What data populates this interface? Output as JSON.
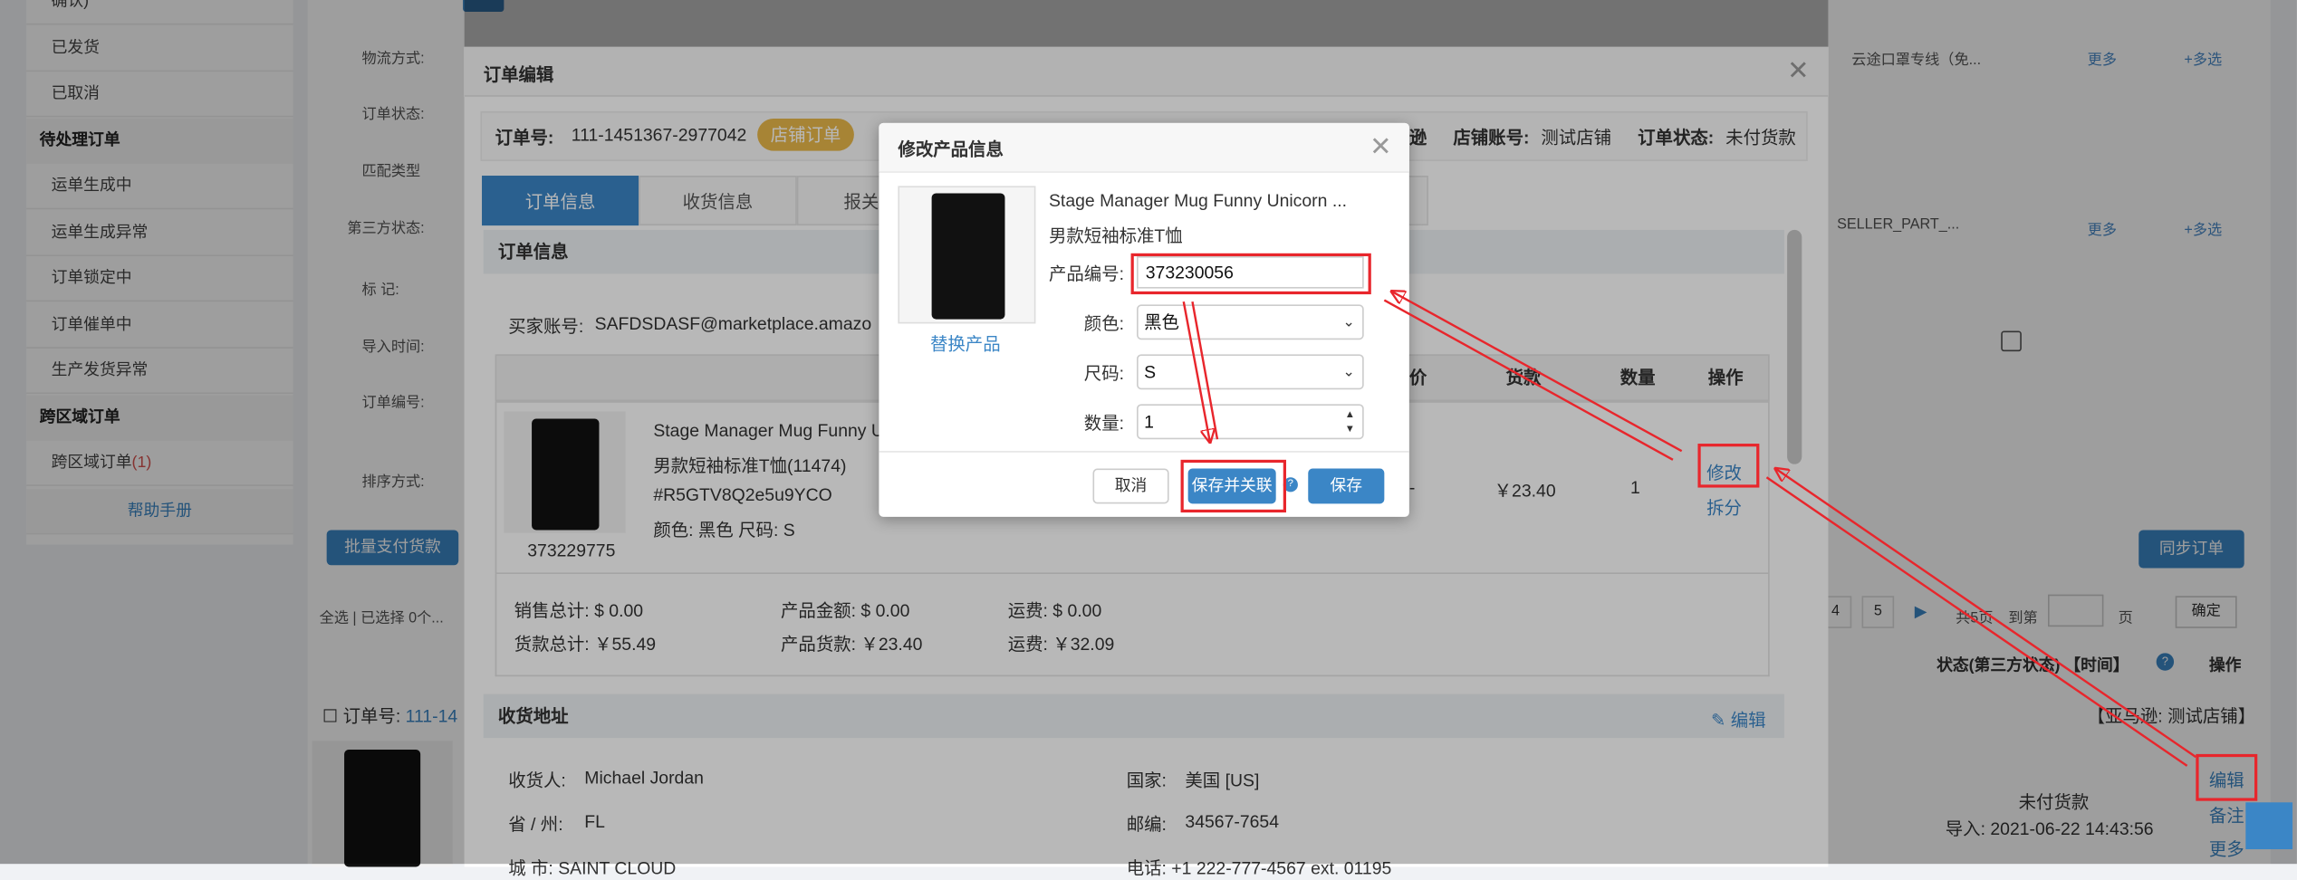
{
  "sidebar": {
    "items_top": [
      "确认)",
      "已发货",
      "已取消"
    ],
    "group_pending": "待处理订单",
    "pending_items": [
      "运单生成中",
      "运单生成异常",
      "订单锁定中",
      "订单催单中",
      "生产发货异常"
    ],
    "group_cross": "跨区域订单",
    "cross_item": "跨区域订单",
    "cross_count": "(1)",
    "help": "帮助手册"
  },
  "filters": {
    "labels": [
      "物流方式:",
      "订单状态:",
      "匹配类型",
      "第三方状态:",
      "标 记:",
      "导入时间:",
      "订单编号:",
      "排序方式:"
    ],
    "logistics_tail": "云途口罩专线（免...",
    "seller_part": "SELLER_PART_...",
    "more": "更多",
    "multi": "+多选"
  },
  "list": {
    "batch_pay": "批量支付货款",
    "sync": "同步订单",
    "select_all": "全选 | 已选择 0个...",
    "pages": [
      "4",
      "5"
    ],
    "total_pages": "共5页",
    "goto": "到第",
    "page_unit": "页",
    "confirm": "确定",
    "status_header": "状态(第三方状态) 【时间】",
    "ops_header": "操作",
    "order_prefix": "订单号:",
    "order_no_short": "111-14",
    "store_tag": "【亚马逊: 测试店铺】",
    "edit": "编辑",
    "remark": "备注",
    "more": "更多",
    "unpaid": "未付货款",
    "import_time": "导入: 2021-06-22 14:43:56"
  },
  "order_modal": {
    "title": "订单编辑",
    "order_no_label": "订单号:",
    "order_no": "111-1451367-2977042",
    "shop_badge": "店铺订单",
    "platform_tail": "逊",
    "store_label": "店铺账号:",
    "store": "测试店铺",
    "status_label": "订单状态:",
    "status": "未付货款",
    "tabs": [
      "订单信息",
      "收货信息",
      "报关信"
    ],
    "section_order": "订单信息",
    "buyer_label": "买家账号:",
    "buyer": "SAFDSDASF@marketplace.amazo",
    "table_headers": [
      "价",
      "货款",
      "数量",
      "操作"
    ],
    "product_name": "Stage Manager Mug Funny U",
    "product_type": "男款短袖标准T恤(11474)",
    "sku": "#R5GTV8Q2e5u9YCO",
    "color_size": "颜色: 黑色   尺码: S",
    "product_code": "373229775",
    "price_dash": "-",
    "price": "￥23.40",
    "qty": "1",
    "action_modify": "修改",
    "action_split": "拆分",
    "totals": {
      "sales_total": "销售总计: $ 0.00",
      "product_amount": "产品金额: $ 0.00",
      "shipping1": "运费: $ 0.00",
      "payment_total": "货款总计: ￥55.49",
      "product_payment": "产品货款: ￥23.40",
      "shipping2": "运费: ￥32.09"
    },
    "section_address": "收货地址",
    "edit": "编辑",
    "receiver_label": "收货人:",
    "receiver": "Michael Jordan",
    "country_label": "国家:",
    "country": "美国 [US]",
    "province_label": "省 / 州:",
    "province": "FL",
    "zip_label": "邮编:",
    "zip": "34567-7654",
    "city_partial": "城 市: SAINT CLOUD",
    "phone_partial": "电话: +1 222-777-4567 ext. 01195"
  },
  "product_dialog": {
    "title": "修改产品信息",
    "product_name": "Stage Manager Mug Funny Unicorn ...",
    "product_type": "男款短袖标准T恤",
    "replace": "替换产品",
    "code_label": "产品编号:",
    "code": "373230056",
    "color_label": "颜色:",
    "color": "黑色",
    "size_label": "尺码:",
    "size": "S",
    "qty_label": "数量:",
    "qty": "1",
    "cancel": "取消",
    "save_link": "保存并关联",
    "save": "保存",
    "help_icon": "?"
  },
  "colors": {
    "primary": "#3b86c6",
    "badge": "#e8b84a",
    "annotation": "#e8262c"
  }
}
